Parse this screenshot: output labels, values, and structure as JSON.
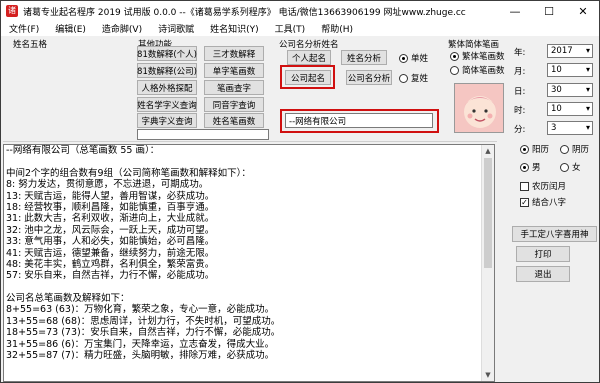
{
  "window": {
    "title": "诸葛专业起名程序 2019 试用版 0.0.0 --《诸葛易学系列程序》  电话/微信13663906199  网址www.zhuge.cc",
    "controls": {
      "minimize": "—",
      "maximize": "☐",
      "close": "✕"
    }
  },
  "menu": [
    "文件(F)",
    "编辑(E)",
    "造命脚(V)",
    "诗词歌赋",
    "姓名知识(Y)",
    "工具(T)",
    "帮助(H)"
  ],
  "left_group_label": "姓名五格",
  "functions": {
    "label": "其他功能",
    "buttons": [
      "81数解释(个人)",
      "三才数解释",
      "81数解释(公司)",
      "单字笔画数",
      "人格外格探配",
      "笔画查字",
      "姓名学字义查询",
      "同音字查询",
      "字典字义查询",
      "姓名笔画数"
    ]
  },
  "company": {
    "label": "公司名分析姓名",
    "buttons": {
      "personal_naming": "个人起名",
      "name_analysis": "姓名分析",
      "company_naming": "公司起名",
      "company_analysis": "公司名分析"
    },
    "modes": {
      "single": "单姓",
      "double": "复姓"
    },
    "name_value": "--网络有限公司"
  },
  "script_type": {
    "label": "繁体简体笔画",
    "options": {
      "traditional": "繁体笔画数",
      "simplified": "简体笔画数"
    }
  },
  "date": {
    "fields": [
      {
        "label": "年:",
        "value": "2017"
      },
      {
        "label": "月:",
        "value": "10"
      },
      {
        "label": "日:",
        "value": "30"
      },
      {
        "label": "时:",
        "value": "10"
      },
      {
        "label": "分:",
        "value": "3"
      }
    ],
    "calendar": {
      "solar": "阳历",
      "lunar": "阴历"
    },
    "gender": {
      "male": "男",
      "female": "女"
    },
    "leap_month": "农历闰月",
    "combine_bazi": "结合八字"
  },
  "side_buttons": {
    "manual_bazi": "手工定八字喜用神",
    "print": "打印",
    "exit": "退出"
  },
  "output": {
    "lines": [
      "--网络有限公司（总笔画数 55 画）：",
      "",
      "中间2个字的组合数有9组（公司简称笔画数和解释如下）：",
      "8: 努力发达，贯彻意愿，不忘进退，可期成功。",
      "13: 天赋吉运，能得人望，善用智谋，必获成功。",
      "18: 经营牧事，顺利昌隆，如能慎重，百事亨通。",
      "31: 此数大吉，名利双收，渐进向上，大业成就。",
      "32: 池中之龙，风云际会，一跃上天，成功可望。",
      "33: 意气用事，人和必失，如能慎始，必可昌隆。",
      "41: 天赋吉运，德望兼备，继续努力，前途无限。",
      "48: 美花丰实，鹤立鸡群，名利俱全，繁荣富贵。",
      "57: 安乐自来，自然吉祥，力行不懈，必能成功。",
      "",
      "公司名总笔画数及解释如下：",
      "8+55=63 (63)：万物化育，繁荣之象，专心一意，必能成功。",
      "13+55=68 (68)：思虑周详，计划力行，不失时机，可望成功。",
      "18+55=73 (73)：安乐自来，自然吉祥，力行不懈，必能成功。",
      "31+55=86 (6)：万宝集门，天降幸运，立志奋发，得成大业。",
      "32+55=87 (7)：精力旺盛，头脑明敏，排除万难，必获成功。"
    ]
  }
}
